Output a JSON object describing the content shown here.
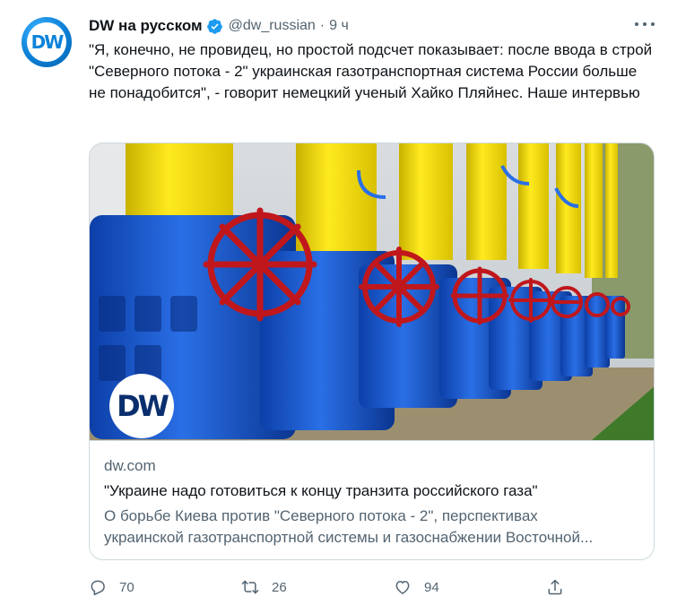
{
  "account": {
    "name": "DW на русском",
    "handle": "@dw_russian",
    "separator": "·",
    "time": "9 ч",
    "avatar_text": "DW",
    "verified": true
  },
  "tweet": {
    "text": "\"Я, конечно, не провидец, но простой подсчет показывает: после ввода в строй \"Северного потока - 2\" украинская газотранспортная система России больше не понадобится\", - говорит немецкий ученый Хайко Пляйнес. Наше интервью"
  },
  "card": {
    "image_logo": "DW",
    "domain": "dw.com",
    "title": "\"Украине надо готовиться к концу транзита российского газа\"",
    "description_line1": "О борьбе Киева против \"Северного потока - 2\", перспективах",
    "description_line2": "украинской газотранспортной системы и газоснабжении Восточной..."
  },
  "actions": {
    "reply_count": "70",
    "retweet_count": "26",
    "like_count": "94"
  },
  "colors": {
    "text_primary": "#0f1419",
    "text_secondary": "#536471",
    "verified": "#1d9bf0",
    "border": "#cfd9de",
    "dw_blue": "#0b83d9"
  },
  "icons": [
    "verified-badge-icon",
    "more-icon",
    "reply-icon",
    "retweet-icon",
    "like-icon",
    "share-icon"
  ]
}
